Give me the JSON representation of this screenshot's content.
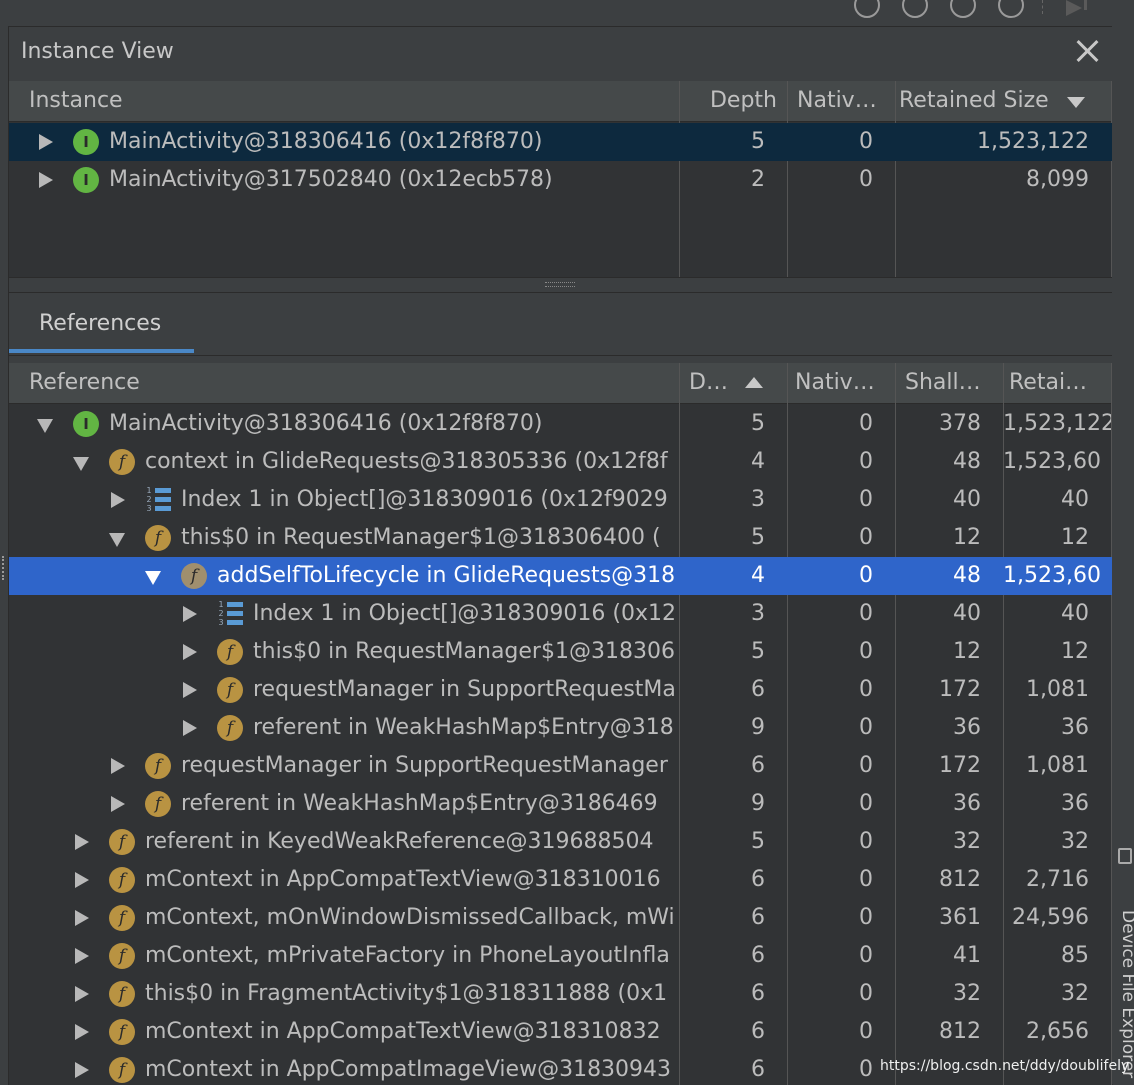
{
  "panel": {
    "title": "Instance View"
  },
  "instance_table": {
    "columns": {
      "instance": "Instance",
      "depth": "Depth",
      "native": "Nativ…",
      "retained": "Retained Size"
    },
    "sort_icon": "triangle-down",
    "rows": [
      {
        "label": "MainActivity@318306416 (0x12f8f870)",
        "depth": "5",
        "native": "0",
        "retained": "1,523,122"
      },
      {
        "label": "MainActivity@317502840 (0x12ecb578)",
        "depth": "2",
        "native": "0",
        "retained": "8,099"
      }
    ]
  },
  "tabs": {
    "references": "References"
  },
  "ref_table": {
    "columns": {
      "reference": "Reference",
      "depth": "D…",
      "native": "Nativ…",
      "shallow": "Shall…",
      "retained": "Retai…"
    },
    "sort_icon": "triangle-up",
    "rows": [
      {
        "label": "MainActivity@318306416 (0x12f8f870)",
        "depth": "5",
        "native": "0",
        "shallow": "378",
        "retained": "1,523,122",
        "icon": "I"
      },
      {
        "label": "context in GlideRequests@318305336 (0x12f8f",
        "depth": "4",
        "native": "0",
        "shallow": "48",
        "retained": "1,523,60",
        "icon": "f"
      },
      {
        "label": "Index 1 in Object[]@318309016 (0x12f9029",
        "depth": "3",
        "native": "0",
        "shallow": "40",
        "retained": "40",
        "icon": "index"
      },
      {
        "label": "this$0 in RequestManager$1@318306400 (",
        "depth": "5",
        "native": "0",
        "shallow": "12",
        "retained": "12",
        "icon": "f"
      },
      {
        "label": "addSelfToLifecycle in GlideRequests@318",
        "depth": "4",
        "native": "0",
        "shallow": "48",
        "retained": "1,523,60",
        "icon": "f"
      },
      {
        "label": "Index 1 in Object[]@318309016 (0x12",
        "depth": "3",
        "native": "0",
        "shallow": "40",
        "retained": "40",
        "icon": "index"
      },
      {
        "label": "this$0 in RequestManager$1@318306",
        "depth": "5",
        "native": "0",
        "shallow": "12",
        "retained": "12",
        "icon": "f"
      },
      {
        "label": "requestManager in SupportRequestMa",
        "depth": "6",
        "native": "0",
        "shallow": "172",
        "retained": "1,081",
        "icon": "f"
      },
      {
        "label": "referent in WeakHashMap$Entry@318",
        "depth": "9",
        "native": "0",
        "shallow": "36",
        "retained": "36",
        "icon": "f"
      },
      {
        "label": "requestManager in SupportRequestManager",
        "depth": "6",
        "native": "0",
        "shallow": "172",
        "retained": "1,081",
        "icon": "f"
      },
      {
        "label": "referent in WeakHashMap$Entry@3186469",
        "depth": "9",
        "native": "0",
        "shallow": "36",
        "retained": "36",
        "icon": "f"
      },
      {
        "label": "referent in KeyedWeakReference@319688504",
        "depth": "5",
        "native": "0",
        "shallow": "32",
        "retained": "32",
        "icon": "f"
      },
      {
        "label": "mContext in AppCompatTextView@318310016",
        "depth": "6",
        "native": "0",
        "shallow": "812",
        "retained": "2,716",
        "icon": "f"
      },
      {
        "label": "mContext, mOnWindowDismissedCallback, mWi",
        "depth": "6",
        "native": "0",
        "shallow": "361",
        "retained": "24,596",
        "icon": "f"
      },
      {
        "label": "mContext, mPrivateFactory in PhoneLayoutInfla",
        "depth": "6",
        "native": "0",
        "shallow": "41",
        "retained": "85",
        "icon": "f"
      },
      {
        "label": "this$0 in FragmentActivity$1@318311888 (0x1",
        "depth": "6",
        "native": "0",
        "shallow": "32",
        "retained": "32",
        "icon": "f"
      },
      {
        "label": "mContext in AppCompatTextView@318310832",
        "depth": "6",
        "native": "0",
        "shallow": "812",
        "retained": "2,656",
        "icon": "f"
      },
      {
        "label": "mContext in AppCompatImageView@31830943",
        "depth": "6",
        "native": "0",
        "shallow": "",
        "retained": "",
        "icon": "f"
      }
    ]
  },
  "side_panel": {
    "label": "Device File Explorer"
  },
  "watermark": "https://blog.csdn.net/ddy/doublifely"
}
